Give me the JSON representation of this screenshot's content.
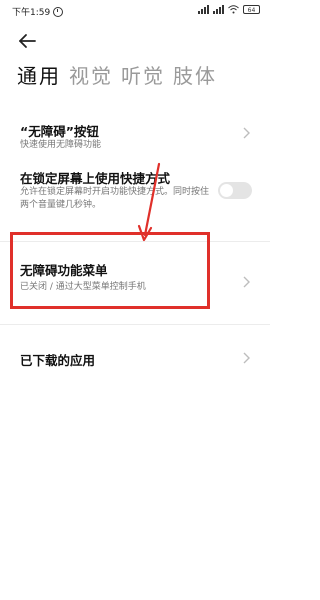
{
  "status_bar": {
    "time": "下午1:59",
    "battery": "64"
  },
  "tabs": [
    {
      "label": "通用",
      "active": true
    },
    {
      "label": "视觉",
      "active": false
    },
    {
      "label": "听觉",
      "active": false
    },
    {
      "label": "肢体",
      "active": false
    }
  ],
  "settings": {
    "accessibility_button": {
      "title": "“无障碍”按钮",
      "subtitle": "快速使用无障碍功能"
    },
    "lock_screen_shortcut": {
      "title": "在锁定屏幕上使用快捷方式",
      "subtitle": "允许在锁定屏幕时开启功能快捷方式。同时按住两个音量键几秒钟。",
      "enabled": false
    },
    "accessibility_menu": {
      "title": "无障碍功能菜单",
      "subtitle": "已关闭 / 通过大型菜单控制手机"
    },
    "downloaded_apps": {
      "title": "已下载的应用"
    }
  },
  "colors": {
    "highlight": "#e0302a",
    "active_tab": "#111111",
    "inactive_tab": "#9a9a9a"
  },
  "icons": [
    "back-arrow-icon",
    "chevron-right-icon",
    "alarm-icon",
    "signal-icon",
    "wifi-icon",
    "battery-icon"
  ]
}
